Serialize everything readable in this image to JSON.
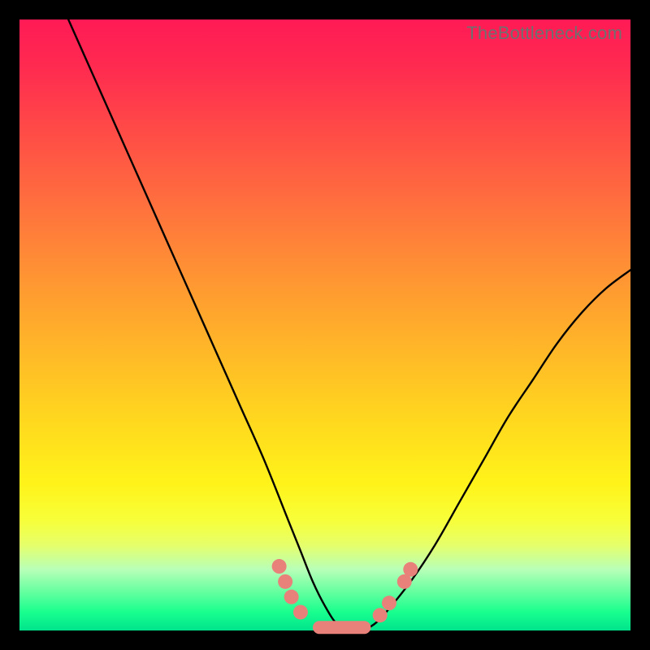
{
  "watermark": "TheBottleneck.com",
  "chart_data": {
    "type": "line",
    "title": "",
    "xlabel": "",
    "ylabel": "",
    "xlim": [
      0,
      100
    ],
    "ylim": [
      0,
      100
    ],
    "grid": false,
    "series": [
      {
        "name": "bottleneck-curve",
        "x": [
          8,
          12,
          16,
          20,
          24,
          28,
          32,
          36,
          40,
          44,
          46,
          48,
          50,
          52,
          54,
          56,
          58,
          60,
          64,
          68,
          72,
          76,
          80,
          84,
          88,
          92,
          96,
          100
        ],
        "y": [
          100,
          91,
          82,
          73,
          64,
          55,
          46,
          37,
          28,
          18,
          13,
          8,
          4,
          1,
          0,
          0,
          1,
          3,
          8,
          14,
          21,
          28,
          35,
          41,
          47,
          52,
          56,
          59
        ]
      }
    ],
    "markers": [
      {
        "shape": "dot",
        "x": 42.5,
        "y": 10.5
      },
      {
        "shape": "dot",
        "x": 43.5,
        "y": 8.0
      },
      {
        "shape": "dot",
        "x": 44.5,
        "y": 5.5
      },
      {
        "shape": "dot",
        "x": 46.0,
        "y": 3.0
      },
      {
        "shape": "pill",
        "x0": 48.0,
        "x1": 57.5,
        "y": 0.5
      },
      {
        "shape": "dot",
        "x": 59.0,
        "y": 2.5
      },
      {
        "shape": "dot",
        "x": 60.5,
        "y": 4.5
      },
      {
        "shape": "dot",
        "x": 63.0,
        "y": 8.0
      },
      {
        "shape": "dot",
        "x": 64.0,
        "y": 10.0
      }
    ],
    "colors": {
      "curve": "#000000",
      "marker": "#e8817a",
      "gradient_top": "#ff1a55",
      "gradient_bottom": "#00e38c"
    }
  }
}
